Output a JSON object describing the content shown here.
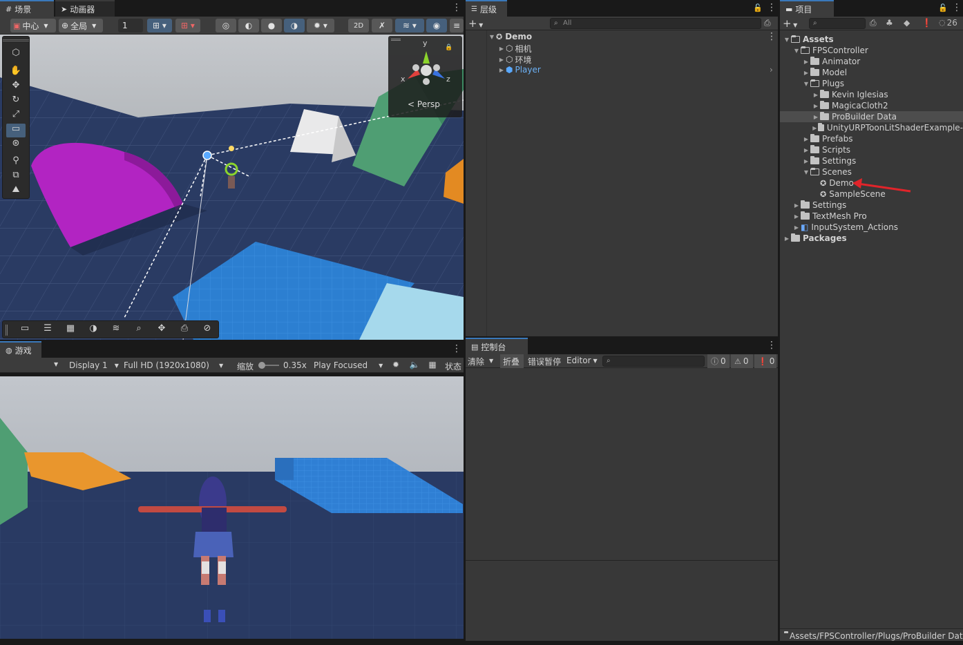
{
  "scene_tabs": {
    "scene": "场景",
    "animator": "动画器"
  },
  "scene_toolbar": {
    "pivot": "中心",
    "global": "全局",
    "snap_value": "1",
    "persp_label": "Persp",
    "gizmo_y": "y",
    "gizmo_x": "x",
    "gizmo_z": "z"
  },
  "game_tab": "游戏",
  "game_toolbar": {
    "display": "Display 1",
    "resolution": "Full HD (1920x1080)",
    "scale_label": "缩放",
    "scale_value": "0.35x",
    "play_mode": "Play Focused",
    "stats": "状态"
  },
  "hierarchy": {
    "tab": "层级",
    "search_placeholder": "All",
    "scene_name": "Demo",
    "items": [
      "相机",
      "环境",
      "Player"
    ]
  },
  "console": {
    "tab": "控制台",
    "clear": "清除",
    "collapse": "折叠",
    "error_pause": "错误暂停",
    "editor": "Editor",
    "log_count": "0",
    "warn_count": "0",
    "error_count": "0"
  },
  "project": {
    "tab": "项目",
    "visible_count": "26",
    "tree": [
      {
        "label": "Assets",
        "indent": 0,
        "bold": true,
        "open": true,
        "arrow": "open"
      },
      {
        "label": "FPSController",
        "indent": 1,
        "open": true,
        "arrow": "open"
      },
      {
        "label": "Animator",
        "indent": 2,
        "arrow": "closed"
      },
      {
        "label": "Model",
        "indent": 2,
        "arrow": "closed"
      },
      {
        "label": "Plugs",
        "indent": 2,
        "open": true,
        "arrow": "open"
      },
      {
        "label": "Kevin Iglesias",
        "indent": 3,
        "arrow": "closed"
      },
      {
        "label": "MagicaCloth2",
        "indent": 3,
        "arrow": "closed"
      },
      {
        "label": "ProBuilder Data",
        "indent": 3,
        "arrow": "closed",
        "selected": true
      },
      {
        "label": "UnityURPToonLitShaderExample-",
        "indent": 3,
        "arrow": "closed"
      },
      {
        "label": "Prefabs",
        "indent": 2,
        "arrow": "closed"
      },
      {
        "label": "Scripts",
        "indent": 2,
        "arrow": "closed"
      },
      {
        "label": "Settings",
        "indent": 2,
        "arrow": "closed"
      },
      {
        "label": "Scenes",
        "indent": 2,
        "open": true,
        "arrow": "open"
      },
      {
        "label": "Demo",
        "indent": 3,
        "scene": true
      },
      {
        "label": "SampleScene",
        "indent": 3,
        "scene": true
      },
      {
        "label": "Settings",
        "indent": 1,
        "arrow": "closed"
      },
      {
        "label": "TextMesh Pro",
        "indent": 1,
        "arrow": "closed"
      },
      {
        "label": "InputSystem_Actions",
        "indent": 1,
        "arrow": "closed",
        "asset": true
      },
      {
        "label": "Packages",
        "indent": 0,
        "bold": true,
        "arrow": "closed"
      }
    ],
    "footer_path": "Assets/FPSController/Plugs/ProBuilder Data"
  },
  "colors": {
    "accent": "#3a79bb",
    "selection": "#2c5d87",
    "annotation_arrow": "#e0242a"
  }
}
